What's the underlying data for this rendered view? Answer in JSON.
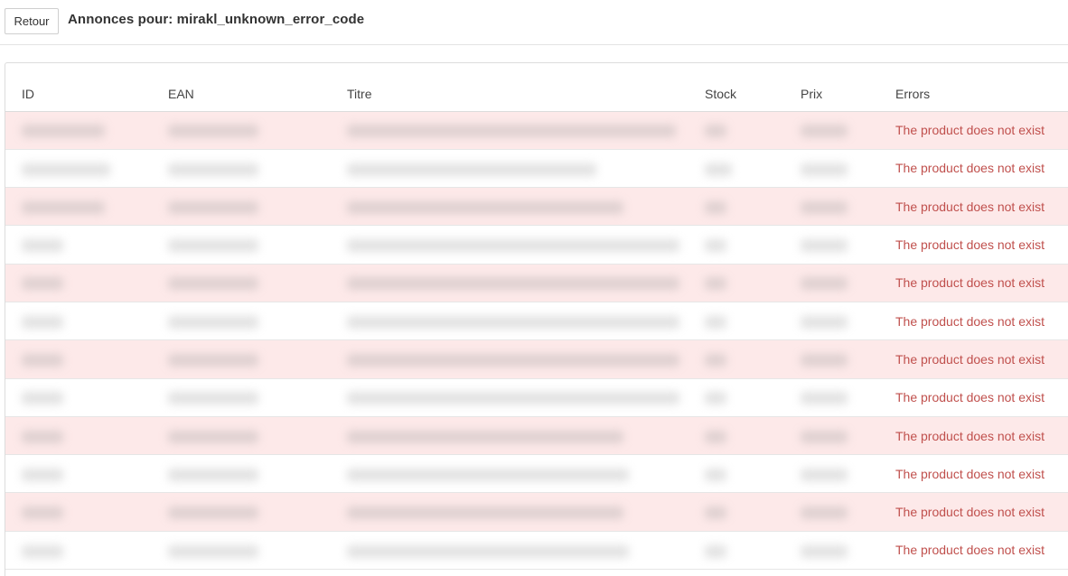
{
  "header": {
    "back_label": "Retour",
    "title": "Annonces pour: mirakl_unknown_error_code"
  },
  "table": {
    "columns": [
      "ID",
      "EAN",
      "Titre",
      "Stock",
      "Prix",
      "Errors"
    ],
    "rows": [
      {
        "error": "The product does not exist",
        "highlighted": true
      },
      {
        "error": "The product does not exist",
        "highlighted": false
      },
      {
        "error": "The product does not exist",
        "highlighted": true
      },
      {
        "error": "The product does not exist",
        "highlighted": false
      },
      {
        "error": "The product does not exist",
        "highlighted": true
      },
      {
        "error": "The product does not exist",
        "highlighted": false
      },
      {
        "error": "The product does not exist",
        "highlighted": true
      },
      {
        "error": "The product does not exist",
        "highlighted": false
      },
      {
        "error": "The product does not exist",
        "highlighted": true
      },
      {
        "error": "The product does not exist",
        "highlighted": false
      },
      {
        "error": "The product does not exist",
        "highlighted": true
      },
      {
        "error": "The product does not exist",
        "highlighted": false
      }
    ]
  },
  "colors": {
    "row_highlight": "#fde9e9",
    "error_text": "#c0504d"
  }
}
